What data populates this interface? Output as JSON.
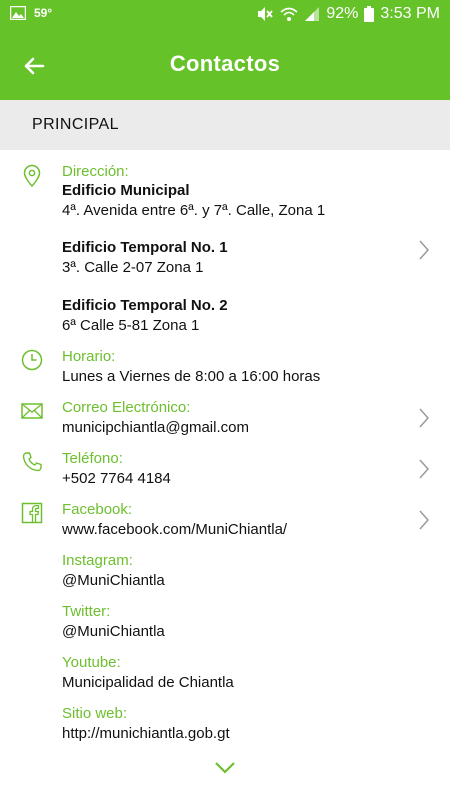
{
  "status_bar": {
    "temperature": "59°",
    "battery": "92%",
    "time": "3:53 PM"
  },
  "app_bar": {
    "title": "Contactos"
  },
  "section": {
    "title": "PRINCIPAL"
  },
  "address": {
    "label": "Dirección:",
    "places": [
      {
        "name": "Edificio Municipal",
        "detail": "4ª. Avenida entre 6ª. y 7ª. Calle, Zona 1"
      },
      {
        "name": "Edificio Temporal No. 1",
        "detail": "3ª. Calle 2-07 Zona 1"
      },
      {
        "name": "Edificio Temporal No. 2",
        "detail": "6ª Calle 5-81 Zona 1"
      }
    ]
  },
  "hours": {
    "label": "Horario:",
    "value": "Lunes a Viernes de 8:00 a 16:00 horas"
  },
  "email": {
    "label": "Correo Electrónico:",
    "value": "municipchiantla@gmail.com"
  },
  "phone": {
    "label": "Teléfono:",
    "value": "+502 7764 4184"
  },
  "facebook": {
    "label": "Facebook:",
    "value": "www.facebook.com/MuniChiantla/"
  },
  "instagram": {
    "label": "Instagram:",
    "value": "@MuniChiantla"
  },
  "twitter": {
    "label": "Twitter:",
    "value": "@MuniChiantla"
  },
  "youtube": {
    "label": "Youtube:",
    "value": "Municipalidad de Chiantla"
  },
  "website": {
    "label": "Sitio web:",
    "value": "http://munichiantla.gob.gt"
  },
  "colors": {
    "primary": "#66c229",
    "label_green": "#6dbf2e",
    "section_bg": "#ebebeb"
  }
}
